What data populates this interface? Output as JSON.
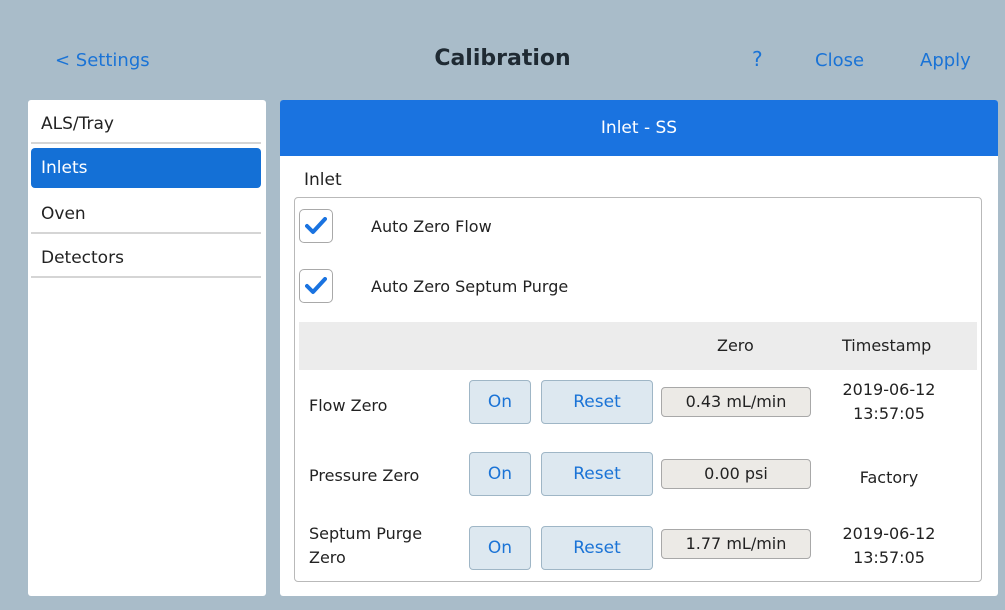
{
  "header": {
    "back_label": "< Settings",
    "title": "Calibration",
    "help_label": "?",
    "close_label": "Close",
    "apply_label": "Apply"
  },
  "sidebar": {
    "items": [
      {
        "label": "ALS/Tray"
      },
      {
        "label": "Inlets"
      },
      {
        "label": "Oven"
      },
      {
        "label": "Detectors"
      }
    ],
    "active_index": 1
  },
  "panel": {
    "title": "Inlet - SS",
    "section_label": "Inlet",
    "checks": [
      {
        "label": "Auto Zero Flow",
        "checked": true
      },
      {
        "label": "Auto Zero Septum Purge",
        "checked": true
      }
    ],
    "table": {
      "headers": {
        "zero": "Zero",
        "timestamp": "Timestamp"
      },
      "rows": [
        {
          "label": "Flow Zero",
          "on_label": "On",
          "reset_label": "Reset",
          "zero": "0.43 mL/min",
          "timestamp": "2019-06-12 13:57:05"
        },
        {
          "label": "Pressure Zero",
          "on_label": "On",
          "reset_label": "Reset",
          "zero": "0.00 psi",
          "timestamp": "Factory"
        },
        {
          "label": "Septum Purge Zero",
          "on_label": "On",
          "reset_label": "Reset",
          "zero": "1.77 mL/min",
          "timestamp": "2019-06-12 13:57:05"
        }
      ]
    }
  },
  "colors": {
    "accent": "#1a73e0",
    "background": "#a9bcc9",
    "link": "#1a73d6"
  }
}
